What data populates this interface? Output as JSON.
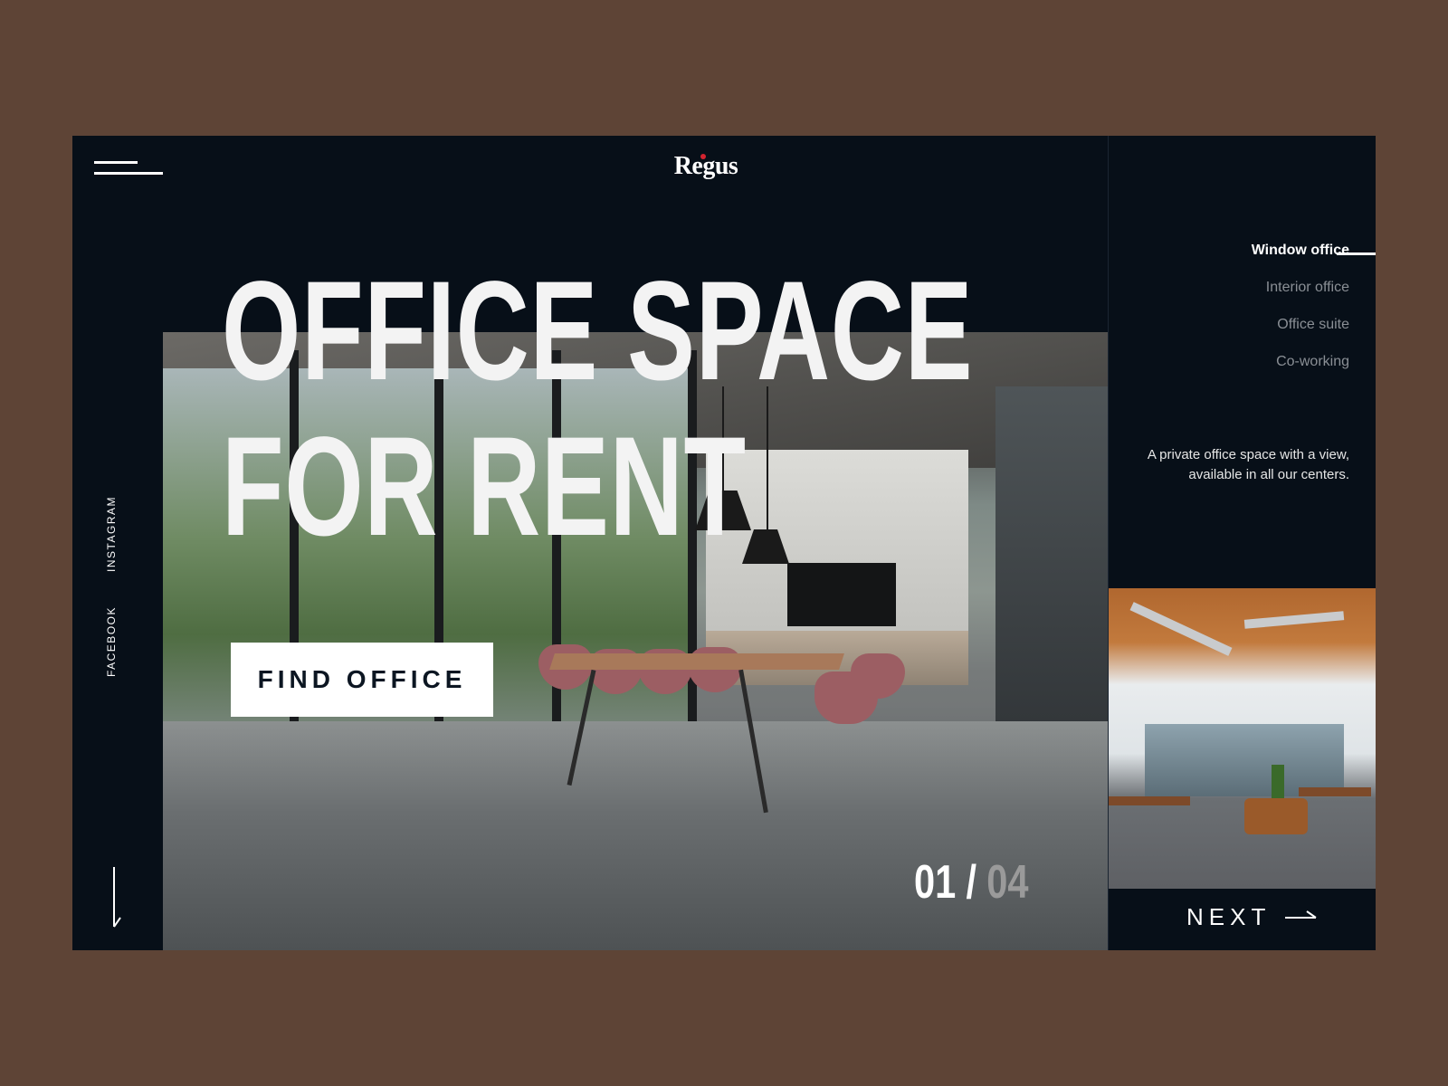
{
  "brand": {
    "logo_text": "Regus",
    "logo_dot_color": "#d3232f"
  },
  "header": {
    "menu_icon": "hamburger-icon"
  },
  "hero": {
    "title_line1": "OFFICE SPACE",
    "title_line2": "FOR RENT",
    "cta_label": "FIND OFFICE"
  },
  "social": {
    "instagram": "INSTAGRAM",
    "facebook": "FACEBOOK"
  },
  "slider": {
    "current": "01",
    "separator": "/",
    "total": "04"
  },
  "sidebar": {
    "menu": [
      {
        "label": "Window office",
        "active": true
      },
      {
        "label": "Interior office",
        "active": false
      },
      {
        "label": "Office suite",
        "active": false
      },
      {
        "label": "Co-working",
        "active": false
      }
    ],
    "description": "A private office space with a view, available in all our centers.",
    "next_label": "NEXT"
  },
  "colors": {
    "page_bg": "#5e4436",
    "card_bg": "#070f18",
    "accent_white": "#ffffff",
    "muted": "#8a8f95"
  },
  "icons": {
    "scroll": "arrow-down-icon",
    "next": "arrow-right-icon"
  }
}
